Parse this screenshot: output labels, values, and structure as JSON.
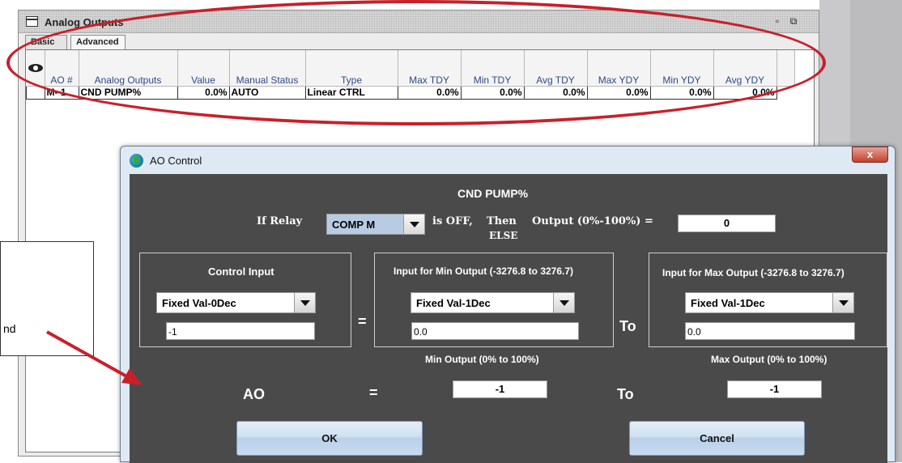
{
  "window": {
    "title": "Analog Outputs",
    "tabs": [
      "Basic",
      "Advanced"
    ],
    "columns": [
      "AO #",
      "Analog Outputs",
      "Value",
      "Manual Status",
      "Type",
      "Max TDY",
      "Min TDY",
      "Avg TDY",
      "Max YDY",
      "Min YDY",
      "Avg YDY"
    ],
    "rows": [
      [
        "M- 1",
        "CND PUMP%",
        "0.0%",
        "AUTO",
        "Linear CTRL",
        "0.0%",
        "0.0%",
        "0.0%",
        "0.0%",
        "0.0%",
        "0.0%"
      ]
    ]
  },
  "callout": {
    "text": "nd"
  },
  "dialog": {
    "title": "AO Control",
    "close_label": "x",
    "output_name": "CND PUMP%",
    "if_relay_label": "If Relay",
    "relay_value": "COMP M",
    "is_off_label": "is OFF,",
    "then_label": "Then",
    "else_label": "ELSE",
    "output_label": "Output (0%-100%) =",
    "output_value": "0",
    "control_input_label": "Control Input",
    "control_input_type": "Fixed Val-0Dec",
    "control_input_value": "-1",
    "equals": "=",
    "min_input_label": "Input for Min Output (-3276.8 to 3276.7)",
    "min_input_type": "Fixed Val-1Dec",
    "min_input_value": "0.0",
    "to_label": "To",
    "max_input_label": "Input for Max Output (-3276.8 to 3276.7)",
    "max_input_type": "Fixed Val-1Dec",
    "max_input_value": "0.0",
    "min_output_label": "Min Output (0% to 100%)",
    "max_output_label": "Max Output (0% to 100%)",
    "ao_label": "AO",
    "min_output_value": "-1",
    "max_output_value": "-1",
    "ok_label": "OK",
    "cancel_label": "Cancel"
  }
}
